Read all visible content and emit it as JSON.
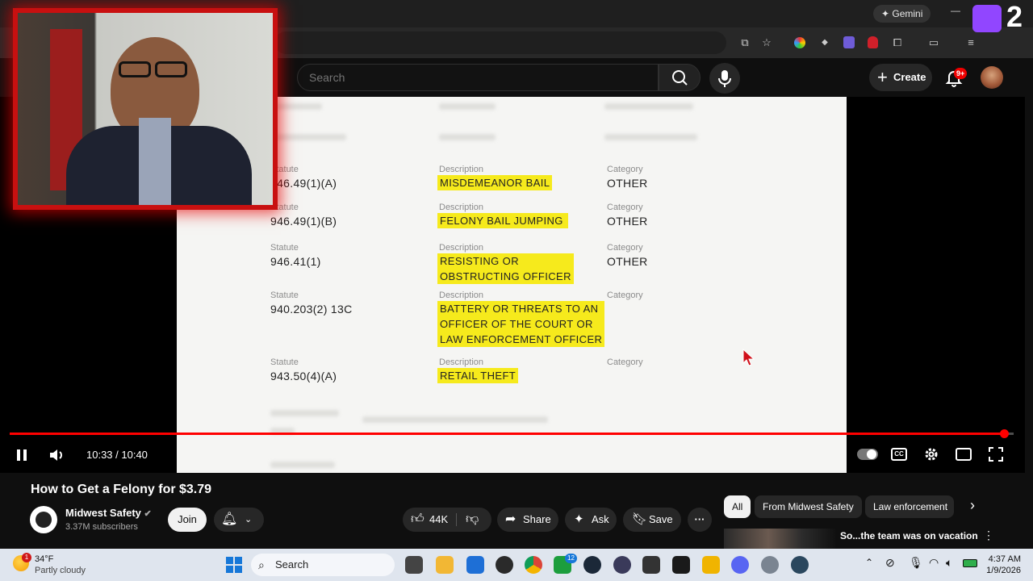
{
  "browser": {
    "gemini_label": "Gemini"
  },
  "header": {
    "search_placeholder": "Search",
    "create_label": "Create",
    "notif_badge": "9+"
  },
  "document": {
    "rows": [
      {
        "statute_label": "Statute",
        "statute": "946.49(1)(A)",
        "desc_label": "Description",
        "desc": [
          "MISDEMEANOR BAIL"
        ],
        "cat_label": "Category",
        "category": "OTHER"
      },
      {
        "statute_label": "Statute",
        "statute": "946.49(1)(B)",
        "desc_label": "Description",
        "desc": [
          "FELONY BAIL JUMPING"
        ],
        "cat_label": "Category",
        "category": "OTHER"
      },
      {
        "statute_label": "Statute",
        "statute": "946.41(1)",
        "desc_label": "Description",
        "desc": [
          "RESISTING OR",
          "OBSTRUCTING OFFICER"
        ],
        "cat_label": "Category",
        "category": "OTHER"
      },
      {
        "statute_label": "Statute",
        "statute": "940.203(2) 13C",
        "desc_label": "Description",
        "desc": [
          "BATTERY OR THREATS TO AN",
          "OFFICER OF THE COURT OR",
          "LAW ENFORCEMENT OFFICER"
        ],
        "cat_label": "Category",
        "category": ""
      },
      {
        "statute_label": "Statute",
        "statute": "943.50(4)(A)",
        "desc_label": "Description",
        "desc": [
          "RETAIL THEFT"
        ],
        "cat_label": "Category",
        "category": ""
      }
    ]
  },
  "player": {
    "time": "10:33 / 10:40",
    "progress": 0.99
  },
  "video": {
    "title": "How to Get a Felony for $3.79",
    "channel": "Midwest Safety",
    "subscribers": "3.37M subscribers",
    "join_label": "Join",
    "likes": "44K",
    "share_label": "Share",
    "ask_label": "Ask",
    "save_label": "Save"
  },
  "chips": [
    "All",
    "From Midwest Safety",
    "Law enforcement"
  ],
  "recommended": {
    "title": "So...the team was on vacation"
  },
  "taskbar": {
    "weather_temp": "34°F",
    "weather_desc": "Partly cloudy",
    "weather_badge": "1",
    "search_label": "Search",
    "store_badge": "12",
    "time": "4:37 AM",
    "date": "1/9/2026"
  },
  "overlay": {
    "twitch_number": "2"
  },
  "colors": {
    "accent_red": "#ff0000",
    "highlight": "#f6ea1c",
    "webcam_border": "#c81010"
  }
}
